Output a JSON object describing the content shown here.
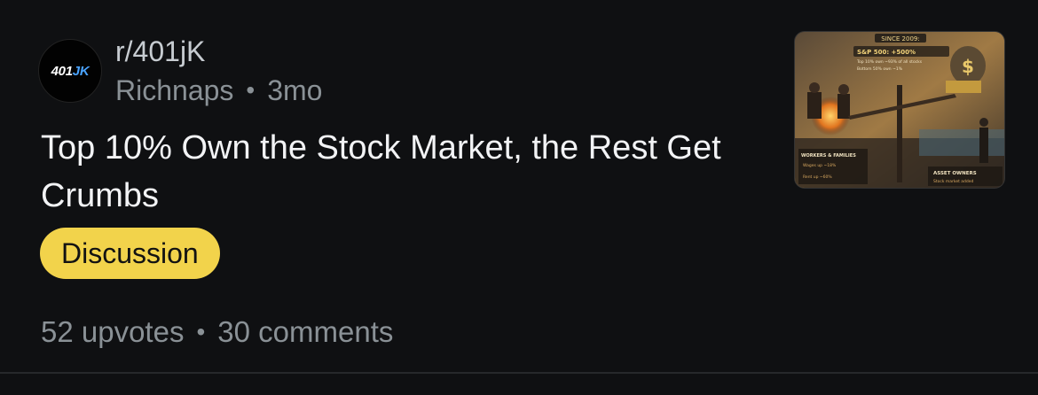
{
  "post": {
    "avatar": {
      "text_main": "401",
      "text_accent": "JK"
    },
    "subreddit": "r/401jK",
    "author": "Richnaps",
    "separator": "•",
    "age": "3mo",
    "title": "Top 10% Own the Stock Market, the Rest Get Crumbs",
    "flair": {
      "label": "Discussion",
      "color": "#f2d34b"
    },
    "upvotes": "52 upvotes",
    "comments": "30 comments",
    "thumbnail": {
      "banner": "SINCE 2009:",
      "line1": "S&P 500: +500%",
      "line2": "Top 10% own ~93% of all stocks",
      "line3": "Bottom 50% own ~1%",
      "left_label": "WORKERS & FAMILIES",
      "left_sub1": "Wages up ~18%",
      "left_sub2": "Rent up ~60%",
      "right_label": "ASSET OWNERS",
      "right_sub": "Stock market added"
    }
  },
  "colors": {
    "background": "#0f1012",
    "title_text": "#f2f3f5",
    "muted_text": "#8a9196"
  }
}
